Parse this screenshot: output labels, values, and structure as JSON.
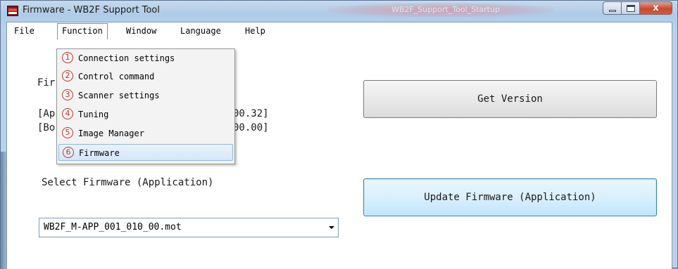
{
  "window": {
    "title": "Firmware - WB2F Support Tool",
    "background_title": "WB2F_Support_Tool_Startup",
    "close_label": "x"
  },
  "menubar": [
    "File",
    "Function",
    "Window",
    "Language",
    "Help"
  ],
  "function_menu": {
    "items": [
      {
        "number": "1",
        "label": "Connection settings"
      },
      {
        "number": "2",
        "label": "Control command"
      },
      {
        "number": "3",
        "label": "Scanner settings"
      },
      {
        "number": "4",
        "label": "Tuning"
      },
      {
        "number": "5",
        "label": "Image Manager"
      },
      {
        "number": "6",
        "label": "Firmware"
      }
    ],
    "highlighted_index": 5
  },
  "firmware_panel": {
    "header_partial": "Fir",
    "app_version_partial_left": "[Ap",
    "app_version_partial_right": "00.32]",
    "boot_version_partial_left": "[Bo",
    "boot_version_partial_right": "00.00]"
  },
  "select_firmware": {
    "label": "Select Firmware (Application)",
    "value": "WB2F_M-APP_001_010_00.mot"
  },
  "buttons": {
    "get_version": "Get Version",
    "update_firmware": "Update Firmware (Application)"
  },
  "colors": {
    "accent_circle": "#c0392b",
    "focus_border": "#3c7fb1"
  }
}
